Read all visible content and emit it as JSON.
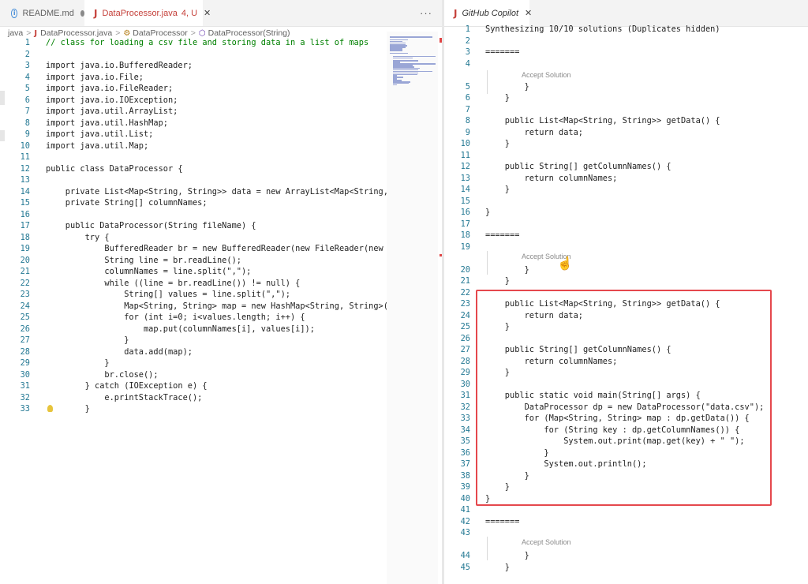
{
  "left": {
    "tabs": [
      {
        "label": "README.md"
      },
      {
        "label": "DataProcessor.java",
        "badge": "4, U"
      }
    ],
    "more_label": "···",
    "breadcrumb": [
      "java",
      "DataProcessor.java",
      "DataProcessor",
      "DataProcessor(String)"
    ],
    "lines": [
      {
        "n": "1",
        "code": "// class for loading a csv file and storing data in a list of maps",
        "cls": "cm"
      },
      {
        "n": "2",
        "code": ""
      },
      {
        "n": "3",
        "code": "import java.io.BufferedReader;"
      },
      {
        "n": "4",
        "code": "import java.io.File;"
      },
      {
        "n": "5",
        "code": "import java.io.FileReader;"
      },
      {
        "n": "6",
        "code": "import java.io.IOException;"
      },
      {
        "n": "7",
        "code": "import java.util.ArrayList;"
      },
      {
        "n": "8",
        "code": "import java.util.HashMap;"
      },
      {
        "n": "9",
        "code": "import java.util.List;"
      },
      {
        "n": "10",
        "code": "import java.util.Map;"
      },
      {
        "n": "11",
        "code": ""
      },
      {
        "n": "12",
        "code": "public class DataProcessor {"
      },
      {
        "n": "13",
        "code": ""
      },
      {
        "n": "14",
        "code": "    private List<Map<String, String>> data = new ArrayList<Map<String, Str"
      },
      {
        "n": "15",
        "code": "    private String[] columnNames;"
      },
      {
        "n": "16",
        "code": ""
      },
      {
        "n": "17",
        "code": "    public DataProcessor(String fileName) {"
      },
      {
        "n": "18",
        "code": "        try {"
      },
      {
        "n": "19",
        "code": "            BufferedReader br = new BufferedReader(new FileReader(new File"
      },
      {
        "n": "20",
        "code": "            String line = br.readLine();"
      },
      {
        "n": "21",
        "code": "            columnNames = line.split(\",\");"
      },
      {
        "n": "22",
        "code": "            while ((line = br.readLine()) != null) {"
      },
      {
        "n": "23",
        "code": "                String[] values = line.split(\",\");"
      },
      {
        "n": "24",
        "code": "                Map<String, String> map = new HashMap<String, String>();"
      },
      {
        "n": "25",
        "code": "                for (int i=0; i<values.length; i++) {"
      },
      {
        "n": "26",
        "code": "                    map.put(columnNames[i], values[i]);"
      },
      {
        "n": "27",
        "code": "                }"
      },
      {
        "n": "28",
        "code": "                data.add(map);"
      },
      {
        "n": "29",
        "code": "            }"
      },
      {
        "n": "30",
        "code": "            br.close();"
      },
      {
        "n": "31",
        "code": "        } catch (IOException e) {"
      },
      {
        "n": "32",
        "code": "            e.printStackTrace();"
      },
      {
        "n": "33",
        "code": "        }"
      }
    ]
  },
  "right": {
    "tab_label": "GitHub Copilot",
    "accept_label": "Accept Solution",
    "lines": [
      {
        "n": "1",
        "code": "Synthesizing 10/10 solutions (Duplicates hidden)"
      },
      {
        "n": "2",
        "code": ""
      },
      {
        "n": "3",
        "code": "======="
      },
      {
        "n": "4",
        "code": ""
      },
      {
        "n": "",
        "code": ""
      },
      {
        "n": "5",
        "code": "        }"
      },
      {
        "n": "6",
        "code": "    }"
      },
      {
        "n": "7",
        "code": ""
      },
      {
        "n": "8",
        "code": "    public List<Map<String, String>> getData() {"
      },
      {
        "n": "9",
        "code": "        return data;"
      },
      {
        "n": "10",
        "code": "    }"
      },
      {
        "n": "11",
        "code": ""
      },
      {
        "n": "12",
        "code": "    public String[] getColumnNames() {"
      },
      {
        "n": "13",
        "code": "        return columnNames;"
      },
      {
        "n": "14",
        "code": "    }"
      },
      {
        "n": "15",
        "code": ""
      },
      {
        "n": "16",
        "code": "}"
      },
      {
        "n": "17",
        "code": ""
      },
      {
        "n": "18",
        "code": "======="
      },
      {
        "n": "19",
        "code": ""
      },
      {
        "n": "",
        "code": ""
      },
      {
        "n": "20",
        "code": "        }"
      },
      {
        "n": "21",
        "code": "    }"
      },
      {
        "n": "22",
        "code": ""
      },
      {
        "n": "23",
        "code": "    public List<Map<String, String>> getData() {"
      },
      {
        "n": "24",
        "code": "        return data;"
      },
      {
        "n": "25",
        "code": "    }"
      },
      {
        "n": "26",
        "code": ""
      },
      {
        "n": "27",
        "code": "    public String[] getColumnNames() {"
      },
      {
        "n": "28",
        "code": "        return columnNames;"
      },
      {
        "n": "29",
        "code": "    }"
      },
      {
        "n": "30",
        "code": ""
      },
      {
        "n": "31",
        "code": "    public static void main(String[] args) {"
      },
      {
        "n": "32",
        "code": "        DataProcessor dp = new DataProcessor(\"data.csv\");"
      },
      {
        "n": "33",
        "code": "        for (Map<String, String> map : dp.getData()) {"
      },
      {
        "n": "34",
        "code": "            for (String key : dp.getColumnNames()) {"
      },
      {
        "n": "35",
        "code": "                System.out.print(map.get(key) + \" \");"
      },
      {
        "n": "36",
        "code": "            }"
      },
      {
        "n": "37",
        "code": "            System.out.println();"
      },
      {
        "n": "38",
        "code": "        }"
      },
      {
        "n": "39",
        "code": "    }"
      },
      {
        "n": "40",
        "code": "}"
      },
      {
        "n": "41",
        "code": ""
      },
      {
        "n": "42",
        "code": "======="
      },
      {
        "n": "43",
        "code": ""
      },
      {
        "n": "",
        "code": ""
      },
      {
        "n": "44",
        "code": "        }"
      },
      {
        "n": "45",
        "code": "    }"
      }
    ]
  }
}
